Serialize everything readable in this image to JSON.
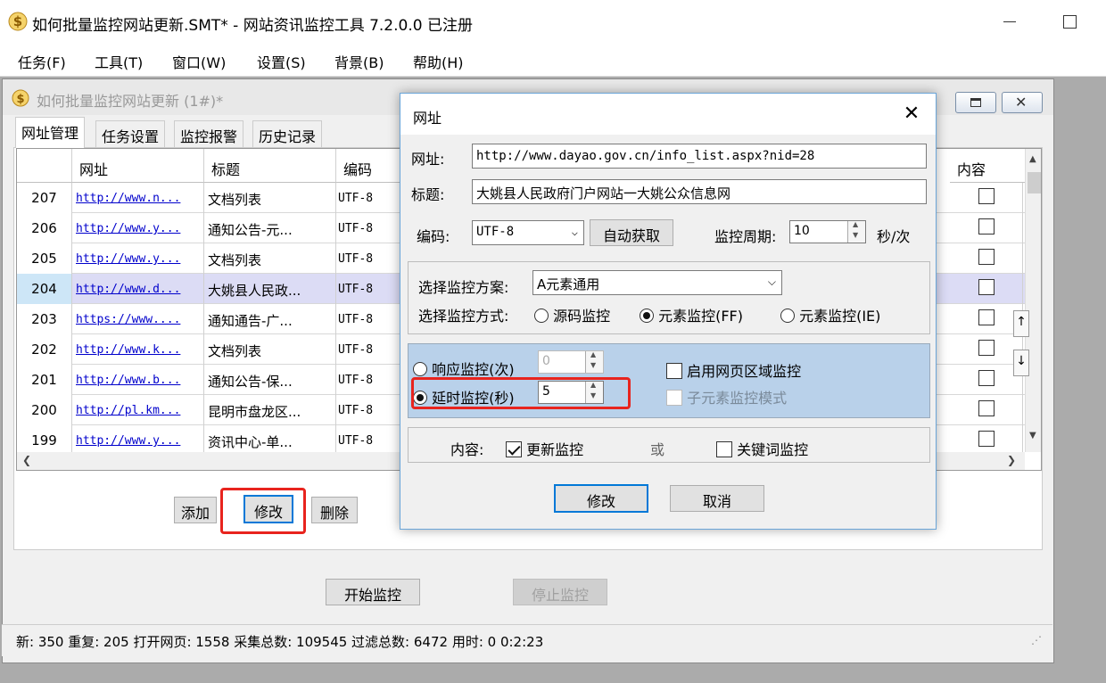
{
  "window": {
    "title": "如何批量监控网站更新.SMT* - 网站资讯监控工具 7.2.0.0  已注册"
  },
  "menu": [
    "任务(F)",
    "工具(T)",
    "窗口(W)",
    "设置(S)",
    "背景(B)",
    "帮助(H)"
  ],
  "child": {
    "title": "如何批量监控网站更新  (1#)*",
    "tabs": [
      "网址管理",
      "任务设置",
      "监控报警",
      "历史记录"
    ]
  },
  "grid": {
    "headers": {
      "url": "网址",
      "title": "标题",
      "encoding": "编码",
      "content": "内容"
    },
    "rows": [
      {
        "num": "207",
        "url": "http://www.n...",
        "title": "文档列表",
        "enc": "UTF-8"
      },
      {
        "num": "206",
        "url": "http://www.y...",
        "title": "通知公告-元...",
        "enc": "UTF-8"
      },
      {
        "num": "205",
        "url": "http://www.y...",
        "title": "文档列表",
        "enc": "UTF-8"
      },
      {
        "num": "204",
        "url": "http://www.d...",
        "title": "大姚县人民政...",
        "enc": "UTF-8"
      },
      {
        "num": "203",
        "url": "https://www....",
        "title": "通知通告-广...",
        "enc": "UTF-8"
      },
      {
        "num": "202",
        "url": "http://www.k...",
        "title": "文档列表",
        "enc": "UTF-8"
      },
      {
        "num": "201",
        "url": "http://www.b...",
        "title": "通知公告-保...",
        "enc": "UTF-8"
      },
      {
        "num": "200",
        "url": "http://pl.km...",
        "title": "昆明市盘龙区...",
        "enc": "UTF-8"
      },
      {
        "num": "199",
        "url": "http://www.y...",
        "title": "资讯中心-单...",
        "enc": "UTF-8"
      }
    ],
    "selected_row": "204"
  },
  "buttons": {
    "add": "添加",
    "edit": "修改",
    "delete": "删除",
    "start": "开始监控",
    "stop": "停止监控"
  },
  "status": "新: 350  重复: 205  打开网页: 1558  采集总数: 109545  过滤总数: 6472  用时:  0 0:2:23",
  "dialog": {
    "title": "网址",
    "url_label": "网址:",
    "url_value": "http://www.dayao.gov.cn/info_list.aspx?nid=28",
    "title_label": "标题:",
    "title_value": "大姚县人民政府门户网站一大姚公众信息网",
    "encoding_label": "编码:",
    "encoding_value": "UTF-8",
    "auto_detect": "自动获取",
    "period_label": "监控周期:",
    "period_value": "10",
    "period_unit": "秒/次",
    "scheme_label": "选择监控方案:",
    "scheme_value": "A元素通用",
    "mode_label": "选择监控方式:",
    "mode_options": [
      "源码监控",
      "元素监控(FF)",
      "元素监控(IE)"
    ],
    "mode_selected": "元素监控(FF)",
    "response_label": "响应监控(次)",
    "response_value": "0",
    "delay_label": "延时监控(秒)",
    "delay_value": "5",
    "region_label": "启用网页区域监控",
    "sub_element_label": "子元素监控模式",
    "content_label": "内容:",
    "update_label": "更新监控",
    "or_label": "或",
    "keyword_label": "关键词监控",
    "ok": "修改",
    "cancel": "取消"
  }
}
